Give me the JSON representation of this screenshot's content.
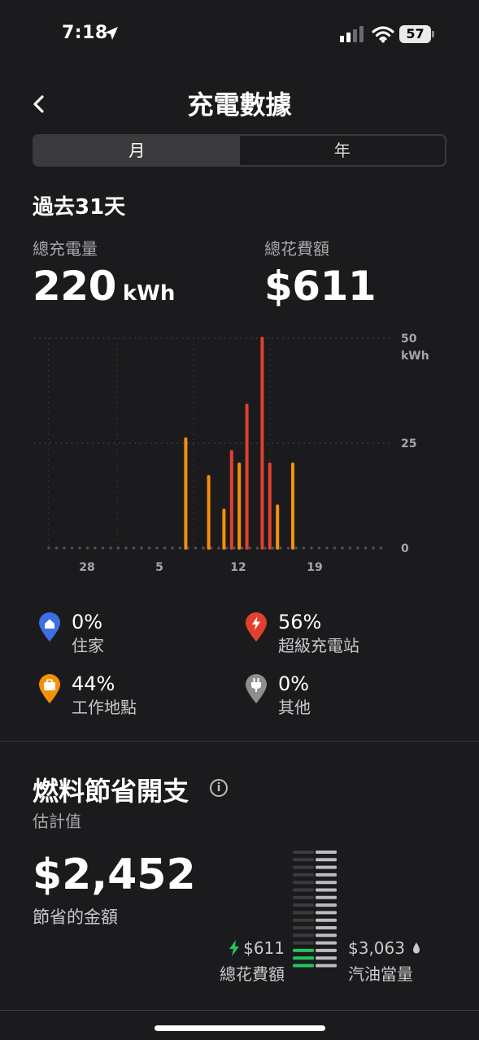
{
  "status_bar": {
    "time": "7:18",
    "battery": "57"
  },
  "header": {
    "title": "充電數據"
  },
  "tabs": [
    {
      "label": "月",
      "active": true
    },
    {
      "label": "年",
      "active": false
    }
  ],
  "period": {
    "label": "過去31天"
  },
  "stats": {
    "energy": {
      "label": "總充電量",
      "value": "220",
      "unit": "kWh"
    },
    "cost": {
      "label": "總花費額",
      "value": "$611"
    }
  },
  "chart_data": {
    "type": "bar",
    "x_ticks": [
      "28",
      "5",
      "12",
      "19"
    ],
    "y_ticks": [
      "0",
      "25",
      "50"
    ],
    "y_unit": "kWh",
    "ylim": [
      0,
      50
    ],
    "grid": true,
    "series": [
      {
        "name": "工作地點",
        "color": "#f5900b",
        "points": [
          {
            "day": 16,
            "value": 26
          },
          {
            "day": 19,
            "value": 17
          },
          {
            "day": 21,
            "value": 9
          },
          {
            "day": 23,
            "value": 20
          },
          {
            "day": 28,
            "value": 10
          },
          {
            "day": 30,
            "value": 20
          }
        ]
      },
      {
        "name": "超級充電站",
        "color": "#e2402e",
        "points": [
          {
            "day": 22,
            "value": 23
          },
          {
            "day": 24,
            "value": 34
          },
          {
            "day": 26,
            "value": 50
          },
          {
            "day": 27,
            "value": 20
          }
        ]
      }
    ]
  },
  "legend": {
    "home": {
      "pct": "0%",
      "name": "住家",
      "color": "#3e6ee6"
    },
    "supercharger": {
      "pct": "56%",
      "name": "超級充電站",
      "color": "#e2402e"
    },
    "work": {
      "pct": "44%",
      "name": "工作地點",
      "color": "#f5900b"
    },
    "other": {
      "pct": "0%",
      "name": "其他",
      "color": "#8e8e91"
    }
  },
  "fuel": {
    "title": "燃料節省開支",
    "subtitle": "估計值",
    "saved": "$2,452",
    "saved_label": "節省的金額",
    "electric_cost": "$611",
    "electric_label": "總花費額",
    "gas_cost": "$3,063",
    "gas_label": "汽油當量",
    "electric_fraction": 0.2,
    "accent": "#22c55e"
  }
}
